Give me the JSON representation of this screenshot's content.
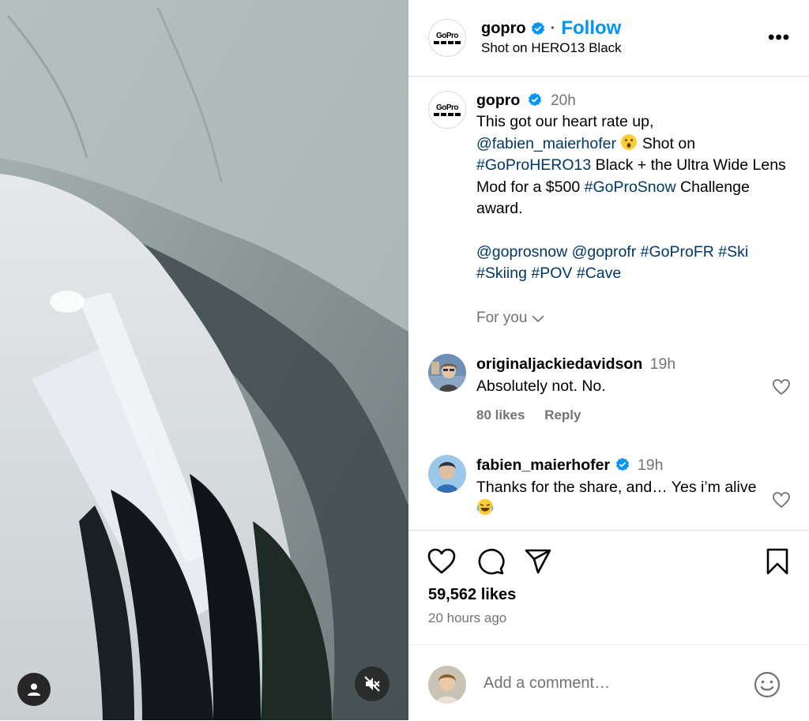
{
  "post": {
    "author": "gopro",
    "follow_label": "Follow",
    "dot": "·",
    "subtitle": "Shot on HERO13 Black",
    "more_label": "•••",
    "logo_text": "GoPro"
  },
  "caption": {
    "author": "gopro",
    "time": "20h",
    "part1": "This got our heart rate up,",
    "mention1": "@fabien_maierhofer",
    "part2": "Shot on",
    "tag1": "#GoProHERO13",
    "part3": "Black + the Ultra Wide Lens Mod for a $500",
    "tag2": "#GoProSnow",
    "part4": "Challenge award.",
    "mention2": "@goprosnow",
    "mention3": "@goprofr",
    "tag3": "#GoProFR",
    "tag4": "#Ski",
    "tag5": "#Skiing",
    "tag6": "#POV",
    "tag7": "#Cave"
  },
  "for_you": "For you",
  "comments": [
    {
      "user": "originaljackiedavidson",
      "time": "19h",
      "text": "Absolutely not. No.",
      "likes": "80 likes",
      "reply": "Reply"
    },
    {
      "user": "fabien_maierhofer",
      "time": "19h",
      "text": "Thanks for the share, and… Yes i’m alive"
    }
  ],
  "stats": {
    "likes": "59,562 likes",
    "ago": "20 hours ago"
  },
  "composer": {
    "placeholder": "Add a comment…"
  },
  "colors": {
    "accent": "#0095f6",
    "link": "#00376b",
    "muted": "#737373",
    "verified": "#0095f6"
  },
  "icons": [
    "verified-badge-icon",
    "more-icon",
    "heart-icon",
    "comment-icon",
    "share-icon",
    "bookmark-icon",
    "chevron-down-icon",
    "user-icon",
    "mute-icon",
    "smiley-icon"
  ]
}
